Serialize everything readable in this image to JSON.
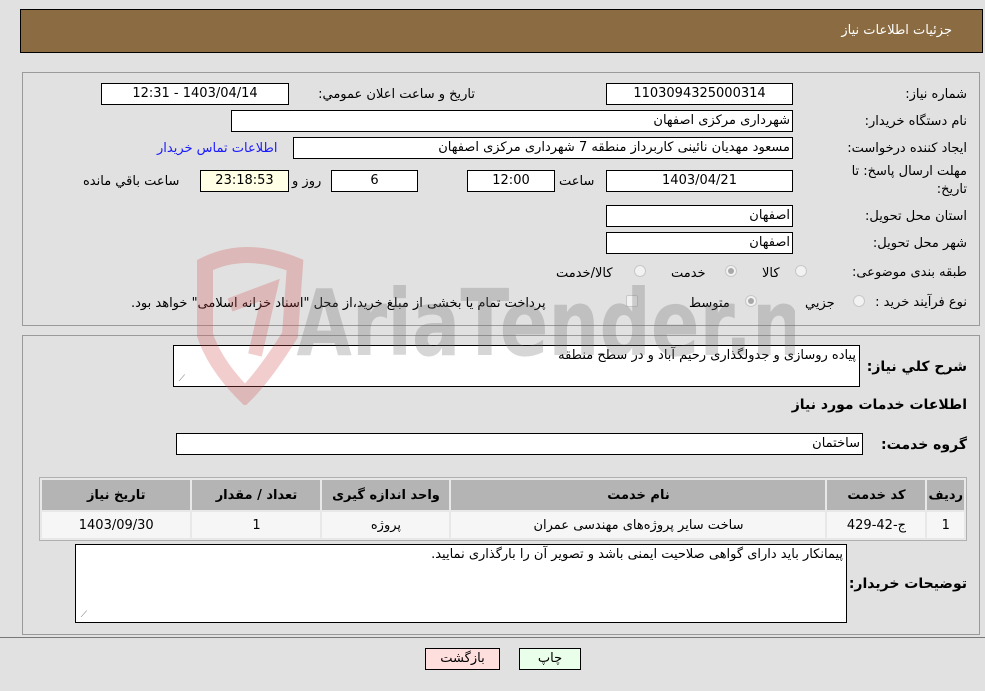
{
  "header": {
    "title": "جزئیات اطلاعات نیاز"
  },
  "form": {
    "need_number_label": "شماره نیاز:",
    "need_number": "1103094325000314",
    "announce_label": "تاریخ و ساعت اعلان عمومي:",
    "announce_value": "1403/04/14 - 12:31",
    "buyer_org_label": "نام دستگاه خریدار:",
    "buyer_org": "شهرداری مرکزی اصفهان",
    "requester_label": "ایجاد کننده درخواست:",
    "requester": "مسعود مهدیان نائینی کاربرداز منطقه 7 شهرداری مرکزی اصفهان",
    "buyer_contact_link": "اطلاعات تماس خریدار",
    "deadline_label_1": "مهلت ارسال پاسخ: تا",
    "deadline_label_2": "تاریخ:",
    "deadline_date": "1403/04/21",
    "time_label": "ساعت",
    "deadline_time": "12:00",
    "days_value": "6",
    "days_label": "روز و",
    "remaining_time": "23:18:53",
    "remaining_label": "ساعت باقي مانده",
    "province_label": "استان محل تحویل:",
    "province": "اصفهان",
    "city_label": "شهر محل تحویل:",
    "city": "اصفهان",
    "category_label": "طبقه بندی موضوعی:",
    "category_options": [
      {
        "label": "کالا",
        "checked": false
      },
      {
        "label": "خدمت",
        "checked": true
      },
      {
        "label": "کالا/خدمت",
        "checked": false
      }
    ],
    "process_label": "نوع فرآیند خرید :",
    "process_options": [
      {
        "label": "جزیي",
        "checked": false
      },
      {
        "label": "متوسط",
        "checked": true
      }
    ],
    "treasury_note": "پرداخت تمام یا بخشی از مبلغ خرید،از محل \"اسناد خزانه اسلامی\" خواهد بود."
  },
  "details": {
    "description_label": "شرح کلي نیاز:",
    "description": "پیاده روسازی و جدولگذاری رحیم آباد و در سطح منطقه",
    "services_heading": "اطلاعات خدمات مورد نیاز",
    "service_group_label": "گروه خدمت:",
    "service_group": "ساختمان",
    "table": {
      "headers": [
        "ردیف",
        "کد خدمت",
        "نام خدمت",
        "واحد اندازه گیری",
        "تعداد / مقدار",
        "تاریخ نیاز"
      ],
      "rows": [
        [
          "1",
          "ج-42-429",
          "ساخت سایر پروژه‌های مهندسی عمران",
          "پروژه",
          "1",
          "1403/09/30"
        ]
      ]
    },
    "buyer_notes_label": "توضیحات خریدار:",
    "buyer_notes": "پیمانکار باید دارای گواهی صلاحیت ایمنی  باشد  و تصویر آن را بارگذاری نمایید."
  },
  "buttons": {
    "print": "چاپ",
    "back": "بازگشت"
  },
  "watermark": {
    "text": "AriaTender.neT"
  }
}
